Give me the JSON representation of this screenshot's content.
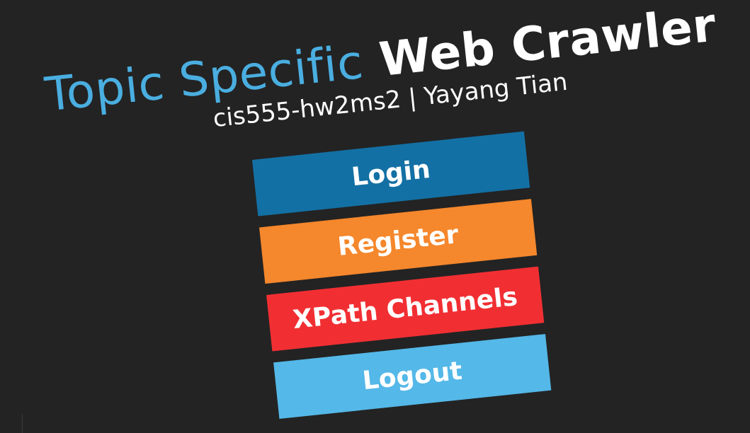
{
  "header": {
    "title_light": "Topic Specific",
    "title_bold": "Web Crawler",
    "subtitle": "cis555-hw2ms2 | Yayang Tian"
  },
  "menu": {
    "login_label": "Login",
    "register_label": "Register",
    "xpath_label": "XPath Channels",
    "logout_label": "Logout"
  },
  "colors": {
    "background": "#232323",
    "title_accent": "#4aaee0",
    "login": "#1370a4",
    "register": "#f5872c",
    "xpath": "#f12f33",
    "logout": "#54b8e8"
  }
}
